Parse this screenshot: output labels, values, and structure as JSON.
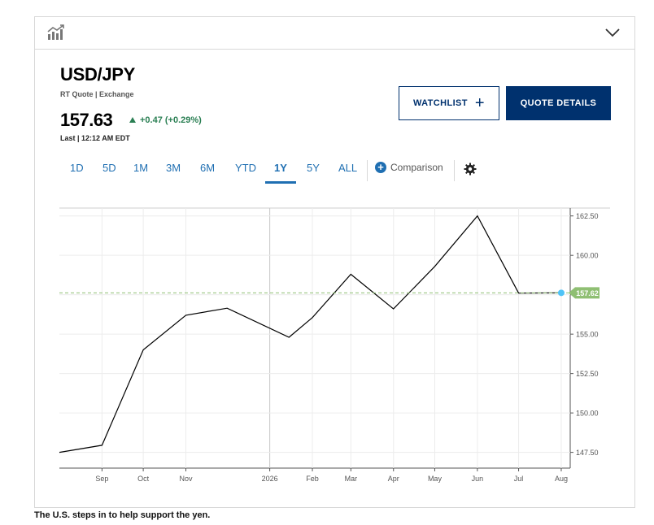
{
  "header": {
    "chart_icon": "bar-chart-trend-icon",
    "collapse_icon": "chevron-down-icon"
  },
  "quote": {
    "symbol": "USD/JPY",
    "source": "RT Quote | Exchange",
    "price": "157.63",
    "change": "+0.47 (+0.29%)",
    "last": "Last | 12:12 AM EDT",
    "change_color": "#2a7f53"
  },
  "buttons": {
    "watchlist": "WATCHLIST",
    "watchlist_icon": "plus-icon",
    "quote_details": "QUOTE DETAILS",
    "brand_color": "#00316e"
  },
  "ranges": {
    "items": [
      "1D",
      "5D",
      "1M",
      "3M",
      "6M",
      "YTD",
      "1Y",
      "5Y",
      "ALL"
    ],
    "active": "1Y",
    "comparison": "Comparison",
    "settings_icon": "gear-icon"
  },
  "chart_data": {
    "type": "line",
    "x_tick_labels": [
      "Sep",
      "Oct",
      "Nov",
      "2026",
      "Feb",
      "Mar",
      "Apr",
      "May",
      "Jun",
      "Jul",
      "Aug"
    ],
    "y_tick_labels": [
      "162.50",
      "160.00",
      "157.50",
      "155.00",
      "152.50",
      "150.00",
      "147.50"
    ],
    "ylim": [
      146.5,
      163.0
    ],
    "series": [
      {
        "points": [
          {
            "x": "2025-08-01",
            "y": 147.5
          },
          {
            "x": "2025-09-01",
            "y": 147.95
          },
          {
            "x": "2025-10-01",
            "y": 154.0
          },
          {
            "x": "2025-11-01",
            "y": 156.2
          },
          {
            "x": "2025-12-01",
            "y": 156.65
          },
          {
            "x": "2026-01-15",
            "y": 154.8
          },
          {
            "x": "2026-02-01",
            "y": 156.05
          },
          {
            "x": "2026-03-01",
            "y": 158.8
          },
          {
            "x": "2026-04-01",
            "y": 156.6
          },
          {
            "x": "2026-05-01",
            "y": 159.3
          },
          {
            "x": "2026-06-01",
            "y": 162.5
          },
          {
            "x": "2026-07-01",
            "y": 157.6
          },
          {
            "x": "2026-08-01",
            "y": 157.62
          }
        ],
        "color": "#000000"
      }
    ],
    "last_value_label": "157.62",
    "last_value_color": "#8fbf73",
    "last_point_color": "#4fc3f7",
    "grid": true
  },
  "caption": "The U.S. steps in to help support the yen."
}
